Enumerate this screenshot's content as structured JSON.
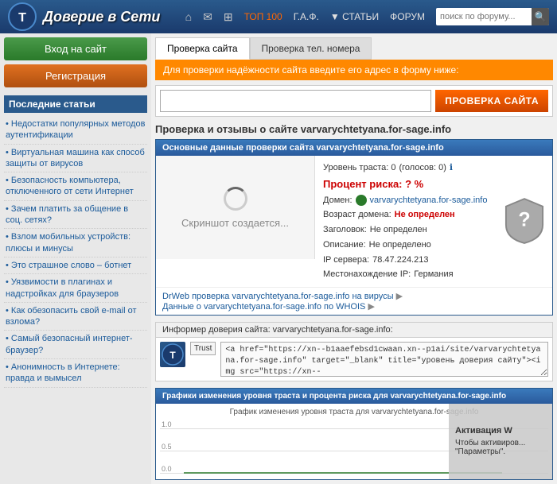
{
  "header": {
    "title": "Доверие в Сети",
    "nav_items": [
      {
        "label": "ТОП 100",
        "active": true
      },
      {
        "label": "Г.А.Ф."
      },
      {
        "label": "▼ СТАТЬИ"
      },
      {
        "label": "ФОРУМ"
      }
    ],
    "search_placeholder": "поиск по форуму..."
  },
  "sidebar": {
    "login_label": "Вход на сайт",
    "register_label": "Регистрация",
    "recent_title": "Последние статьи",
    "articles": [
      "Недостатки популярных методов аутентификации",
      "Виртуальная машина как способ защиты от вирусов",
      "Безопасность компьютера, отключенного от сети Интернет",
      "Зачем платить за общение в соц. сетях?",
      "Взлом мобильных устройств: плюсы и минусы",
      "Это страшное слово – ботнет",
      "Уязвимости в плагинах и надстройках для браузеров",
      "Как обезопасить свой e-mail от взлома?",
      "Самый безопасный интернет-браузер?",
      "Анонимность в Интернете: правда и вымысел"
    ]
  },
  "content": {
    "tabs": [
      {
        "label": "Проверка сайта",
        "active": true
      },
      {
        "label": "Проверка тел. номера",
        "active": false
      }
    ],
    "info_bar": "Для проверки надёжности сайта введите его адрес в форму ниже:",
    "url_placeholder": "",
    "check_button_label": "ПРОВЕРКА САЙТА",
    "result_title": "Проверка и отзывы о сайте varvarychtetyana.for-sage.info",
    "data_panel_header": "Основные данные проверки сайта varvarychtetyana.for-sage.info",
    "trust_level": "Уровень траста: 0",
    "trust_count": "(голосов: 0)",
    "percent_label": "Процент риска: ? %",
    "domain_label": "Домен:",
    "domain_value": "varvarychtetyana.for-sage.info",
    "age_label": "Возраст домена:",
    "age_value": "Не определен",
    "header_label": "Заголовок:",
    "header_value": "Не определен",
    "description_label": "Описание:",
    "description_value": "Не определено",
    "ip_label": "IP сервера:",
    "ip_value": "78.47.224.213",
    "location_label": "Местонахождение IP:",
    "location_value": "Германия",
    "screenshot_text": "Скриншот создается...",
    "antivirus_link": "DrWeb проверка varvarychtetyana.for-sage.info на вирусы",
    "whois_link": "Данные о varvarychtetyana.for-sage.info по WHOIS",
    "informer_header": "Информер доверия сайта: varvarychtetyana.for-sage.info:",
    "informer_code": "<a href=\"https://xn--b1aaefebsd1cwaan.xn--p1ai/site/varvarychtetyana.for-sage.info\" target=\"_blank\" title=\"уровень доверия сайту\"><img src=\"https://xn--",
    "graph_header": "Графики изменения уровня траста и процента риска для varvarychtetyana.for-sage.info",
    "graph_title": "График изменения уровня траста для varvarychtetyana.for-sage.info",
    "graph_labels": [
      "1.0",
      "0.5",
      "0.0"
    ],
    "activation_title": "Активация W",
    "activation_text": "Чтобы активиров... \"Параметры\"."
  }
}
